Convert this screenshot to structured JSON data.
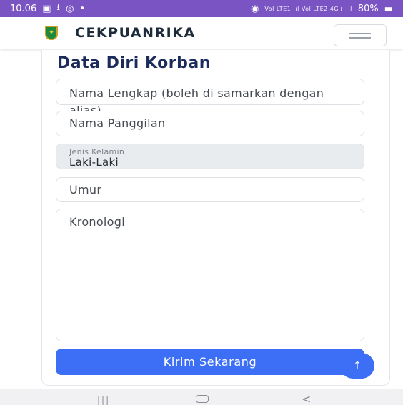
{
  "status_bar": {
    "time": "10.06",
    "network": "Vol LTE1 .ıl Vol LTE2 4G+ .ıl",
    "battery": "80%"
  },
  "navbar": {
    "brand": "CEKPUANRIKA",
    "logo_glyph": "✦"
  },
  "form": {
    "section_title": "Data Diri Korban",
    "nama_lengkap_placeholder": "Nama Lengkap (boleh di samarkan dengan alias)",
    "nama_panggilan_placeholder": "Nama Panggilan",
    "jenis_kelamin_label": "Jenis Kelamin",
    "jenis_kelamin_value": "Laki-Laki",
    "umur_placeholder": "Umur",
    "kronologi_placeholder": "Kronologi",
    "submit_label": "Kirim Sekarang",
    "to_top_glyph": "↑"
  },
  "android_nav": {
    "recents": "|||",
    "back": "<"
  },
  "colors": {
    "status_bar": "#7b54c4",
    "accent": "#3d6ff6",
    "title": "#1a2b5c"
  },
  "icons": {
    "status": [
      "gallery-icon",
      "download-icon",
      "instagram-icon",
      "dot-icon",
      "hotspot-icon",
      "signal-icon",
      "battery-icon"
    ],
    "navbar": [
      "logo-emblem",
      "hamburger-icon"
    ],
    "form": [
      "arrow-up-icon"
    ],
    "system": [
      "recents-icon",
      "home-icon",
      "back-icon"
    ]
  }
}
